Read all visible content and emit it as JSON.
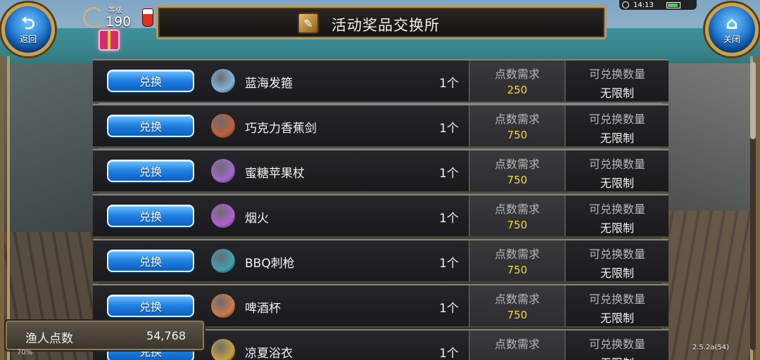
{
  "header": {
    "title": "活动奖品交换所",
    "back_label": "返回",
    "close_label": "关闭"
  },
  "player": {
    "level_label": "等级",
    "level_value": "190"
  },
  "status_bar": {
    "time": "14:13"
  },
  "columns": {
    "cost_header": "点数需求",
    "limit_header": "可兑换数量"
  },
  "items": [
    {
      "button": "兑换",
      "name": "蓝海发箍",
      "qty": "1个",
      "cost": "250",
      "limit": "无限制",
      "icon": "hairband-icon",
      "icon_color": "#7fb4d9"
    },
    {
      "button": "兑换",
      "name": "巧克力香蕉剑",
      "qty": "1个",
      "cost": "750",
      "limit": "无限制",
      "icon": "sword-icon",
      "icon_color": "#c0603a"
    },
    {
      "button": "兑换",
      "name": "蜜糖苹果杖",
      "qty": "1个",
      "cost": "750",
      "limit": "无限制",
      "icon": "staff-icon",
      "icon_color": "#a06ad0"
    },
    {
      "button": "兑换",
      "name": "烟火",
      "qty": "1个",
      "cost": "750",
      "limit": "无限制",
      "icon": "firework-icon",
      "icon_color": "#b060d0"
    },
    {
      "button": "兑换",
      "name": "BBQ刺枪",
      "qty": "1个",
      "cost": "750",
      "limit": "无限制",
      "icon": "spear-icon",
      "icon_color": "#3f9fb0"
    },
    {
      "button": "兑换",
      "name": "啤酒杯",
      "qty": "1个",
      "cost": "750",
      "limit": "无限制",
      "icon": "beer-mug-icon",
      "icon_color": "#d07a4a"
    },
    {
      "button": "兑换",
      "name": "凉夏浴衣",
      "qty": "1个",
      "cost": "",
      "limit": "无限制",
      "icon": "yukata-icon",
      "icon_color": "#c8a040"
    }
  ],
  "points": {
    "label": "渔人点数",
    "value": "54,768"
  },
  "scroll_position": 0.0,
  "version": "2.5.2a(54)",
  "corner_text": "70%",
  "colors": {
    "button_blue": "#1f7fe0",
    "cost_yellow": "#f0d64a",
    "frame_gold": "#b89a5e"
  }
}
